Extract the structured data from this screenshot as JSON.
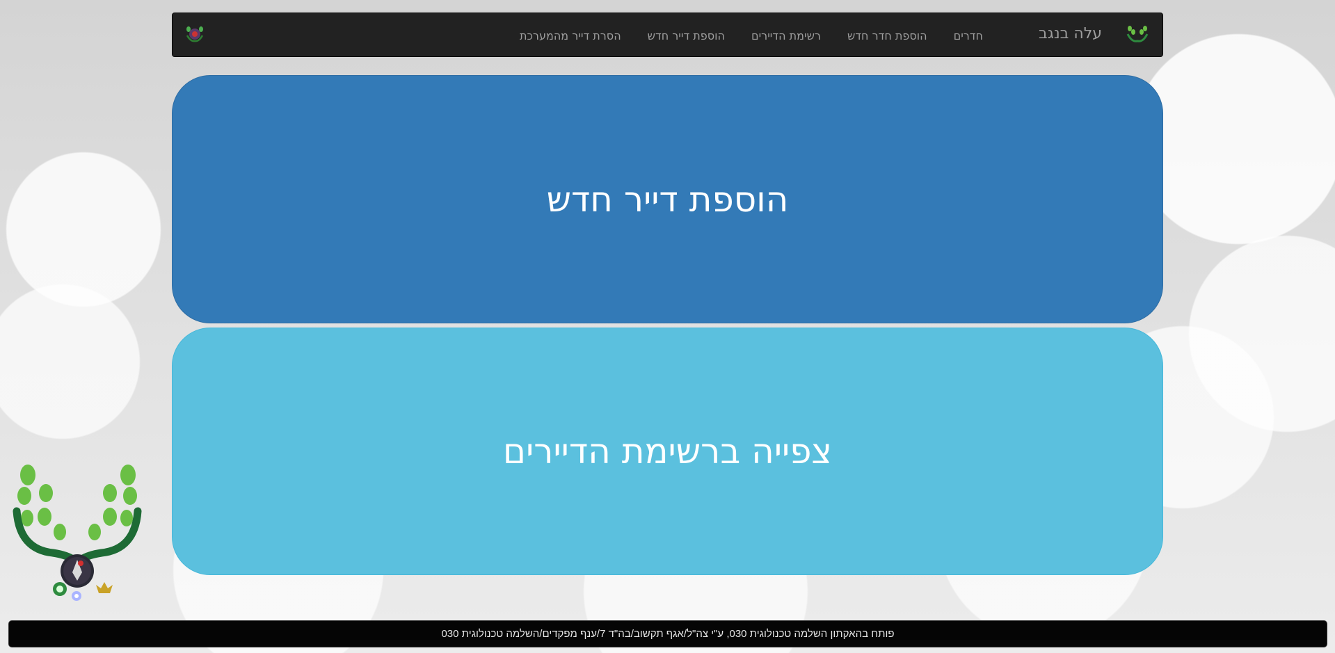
{
  "navbar": {
    "brand": "עלה בנגב",
    "links": [
      "חדרים",
      "הוספת חדר חדש",
      "רשימת הדיירים",
      "הוספת דייר חדש",
      "הסרת דייר מהמערכת"
    ],
    "logo_right_icon": "leaves-hands-logo-icon",
    "logo_left_icon": "emblem-logo-icon"
  },
  "tiles": {
    "add_tenant": "הוספת דייר חדש",
    "view_tenants": "צפייה ברשימת הדיירים"
  },
  "decor": {
    "big_logo_icon": "leaves-hands-emblem-icon"
  },
  "footer": {
    "text": "פותח בהאקתון השלמה טכנולוגית 030, ע\"י צה\"ל/אגף תקשוב/בה\"ד 7/ענף מפקדים/השלמה טכנולוגית 030"
  },
  "colors": {
    "navbar_bg": "#222222",
    "nav_text": "#9d9d9d",
    "primary": "#337ab7",
    "info": "#5bc0de",
    "footer_bg": "#050505"
  }
}
